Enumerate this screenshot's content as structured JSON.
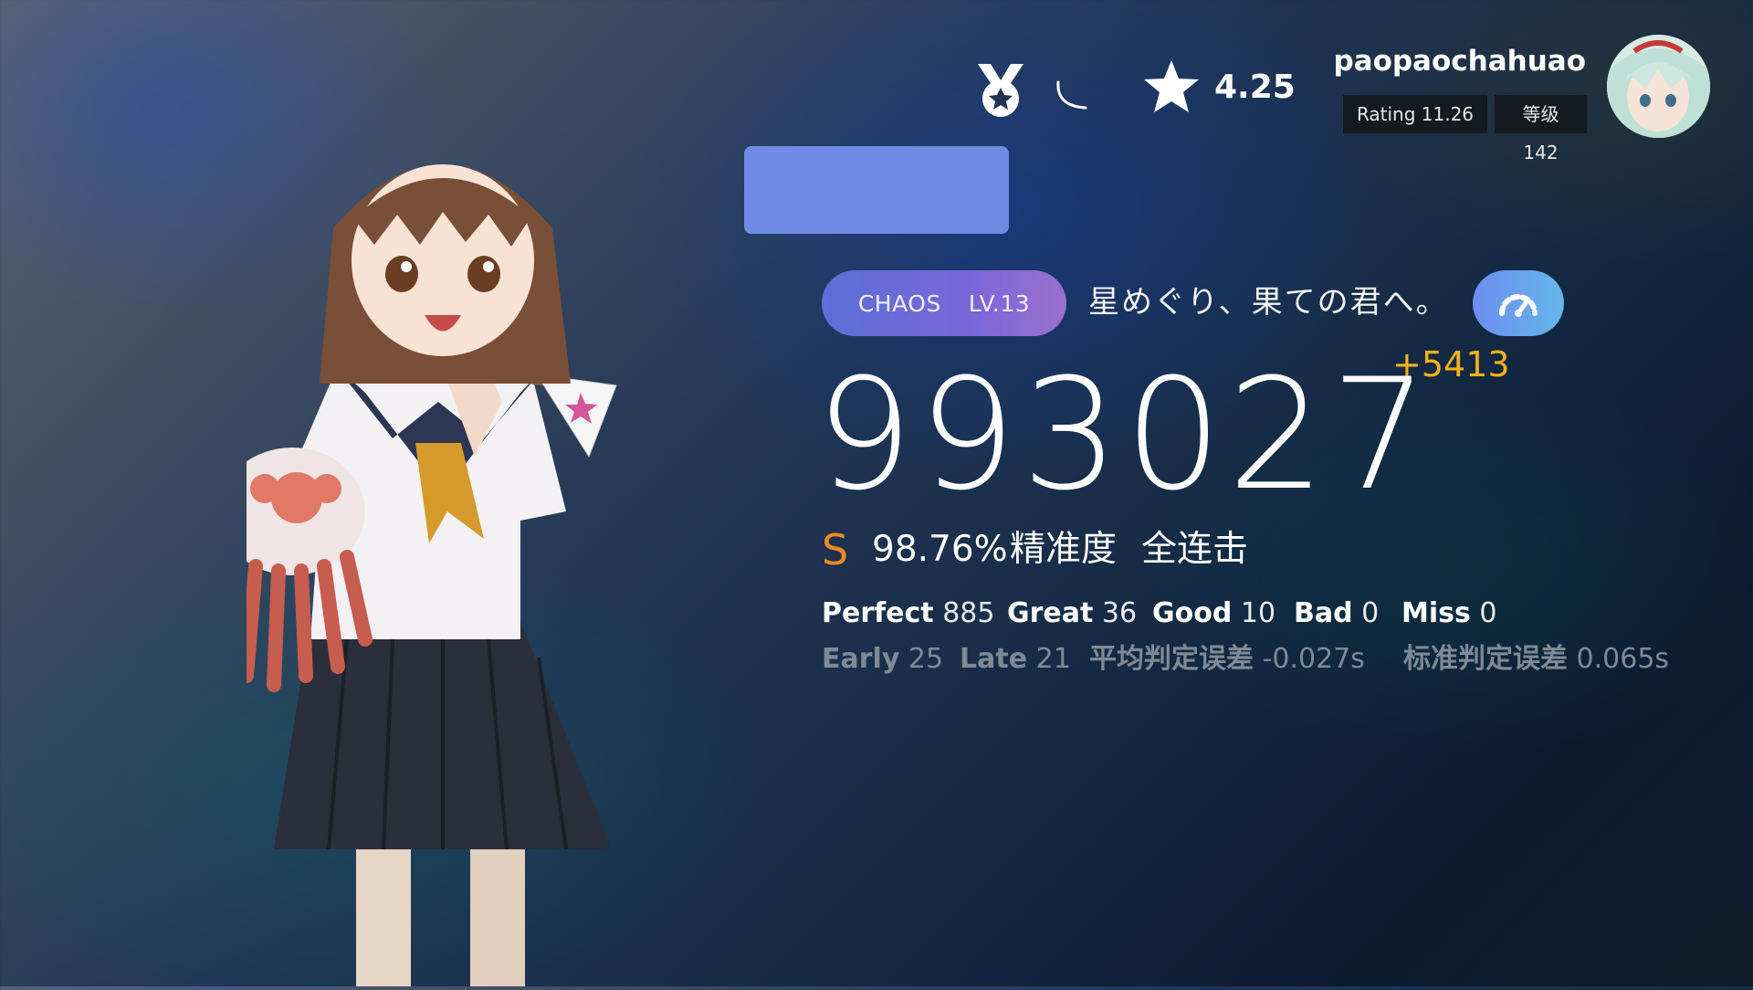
{
  "header": {
    "difficulty_rating": "4.25",
    "username": "paopaochahuao",
    "rating_badge": "Rating 11.26",
    "level_badge": "等级 142",
    "icons": [
      "medal-icon",
      "spinner-icon",
      "star-icon",
      "avatar"
    ]
  },
  "chart": {
    "difficulty": "CHAOS",
    "level": "LV.13",
    "song_title": "星めぐり、果ての君へ。",
    "accent_color": "#6f8be6"
  },
  "result": {
    "score": "993027",
    "score_delta": "+5413",
    "grade": "S",
    "accuracy": "98.76%",
    "accuracy_label": "精准度",
    "full_combo": "全连击"
  },
  "judgements": {
    "perfect_label": "Perfect",
    "perfect": "885",
    "great_label": "Great",
    "great": "36",
    "good_label": "Good",
    "good": "10",
    "bad_label": "Bad",
    "bad": "0",
    "miss_label": "Miss",
    "miss": "0"
  },
  "timing": {
    "early_label": "Early",
    "early": "25",
    "late_label": "Late",
    "late": "21",
    "avg_error_label": "平均判定误差",
    "avg_error": "-0.027s",
    "std_error_label": "标准判定误差",
    "std_error": "0.065s"
  }
}
